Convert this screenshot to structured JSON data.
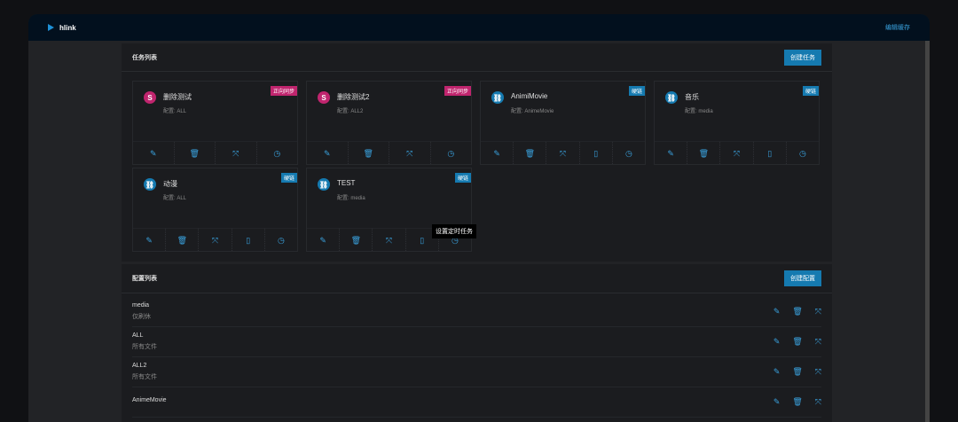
{
  "header": {
    "app_name": "hlink",
    "edit_cache": "编辑缓存"
  },
  "tasks": {
    "title": "任务列表",
    "create": "创建任务",
    "tooltip": "设置定时任务",
    "items": [
      {
        "name": "删除测试",
        "config": "配置: ALL",
        "tag": "正向同步",
        "kind": "pink",
        "icon": "S"
      },
      {
        "name": "删除测试2",
        "config": "配置: ALL2",
        "tag": "正向同步",
        "kind": "pink",
        "icon": "S"
      },
      {
        "name": "AnimiMovie",
        "config": "配置: AnimeMovie",
        "tag": "硬链",
        "kind": "blue",
        "icon": "⛓"
      },
      {
        "name": "音乐",
        "config": "配置: media",
        "tag": "硬链",
        "kind": "blue",
        "icon": "⛓"
      },
      {
        "name": "动漫",
        "config": "配置: ALL",
        "tag": "硬链",
        "kind": "blue",
        "icon": "⛓"
      },
      {
        "name": "TEST",
        "config": "配置: media",
        "tag": "硬链",
        "kind": "blue",
        "icon": "⛓"
      }
    ]
  },
  "configs": {
    "title": "配置列表",
    "create": "创建配置",
    "items": [
      {
        "name": "media",
        "desc": "仅刷休"
      },
      {
        "name": "ALL",
        "desc": "所有文件"
      },
      {
        "name": "ALL2",
        "desc": "所有文件"
      },
      {
        "name": "AnimeMovie",
        "desc": ""
      }
    ]
  },
  "colors": {
    "accent": "#157ab0",
    "pink": "#c0256e",
    "header": "#02101e"
  }
}
